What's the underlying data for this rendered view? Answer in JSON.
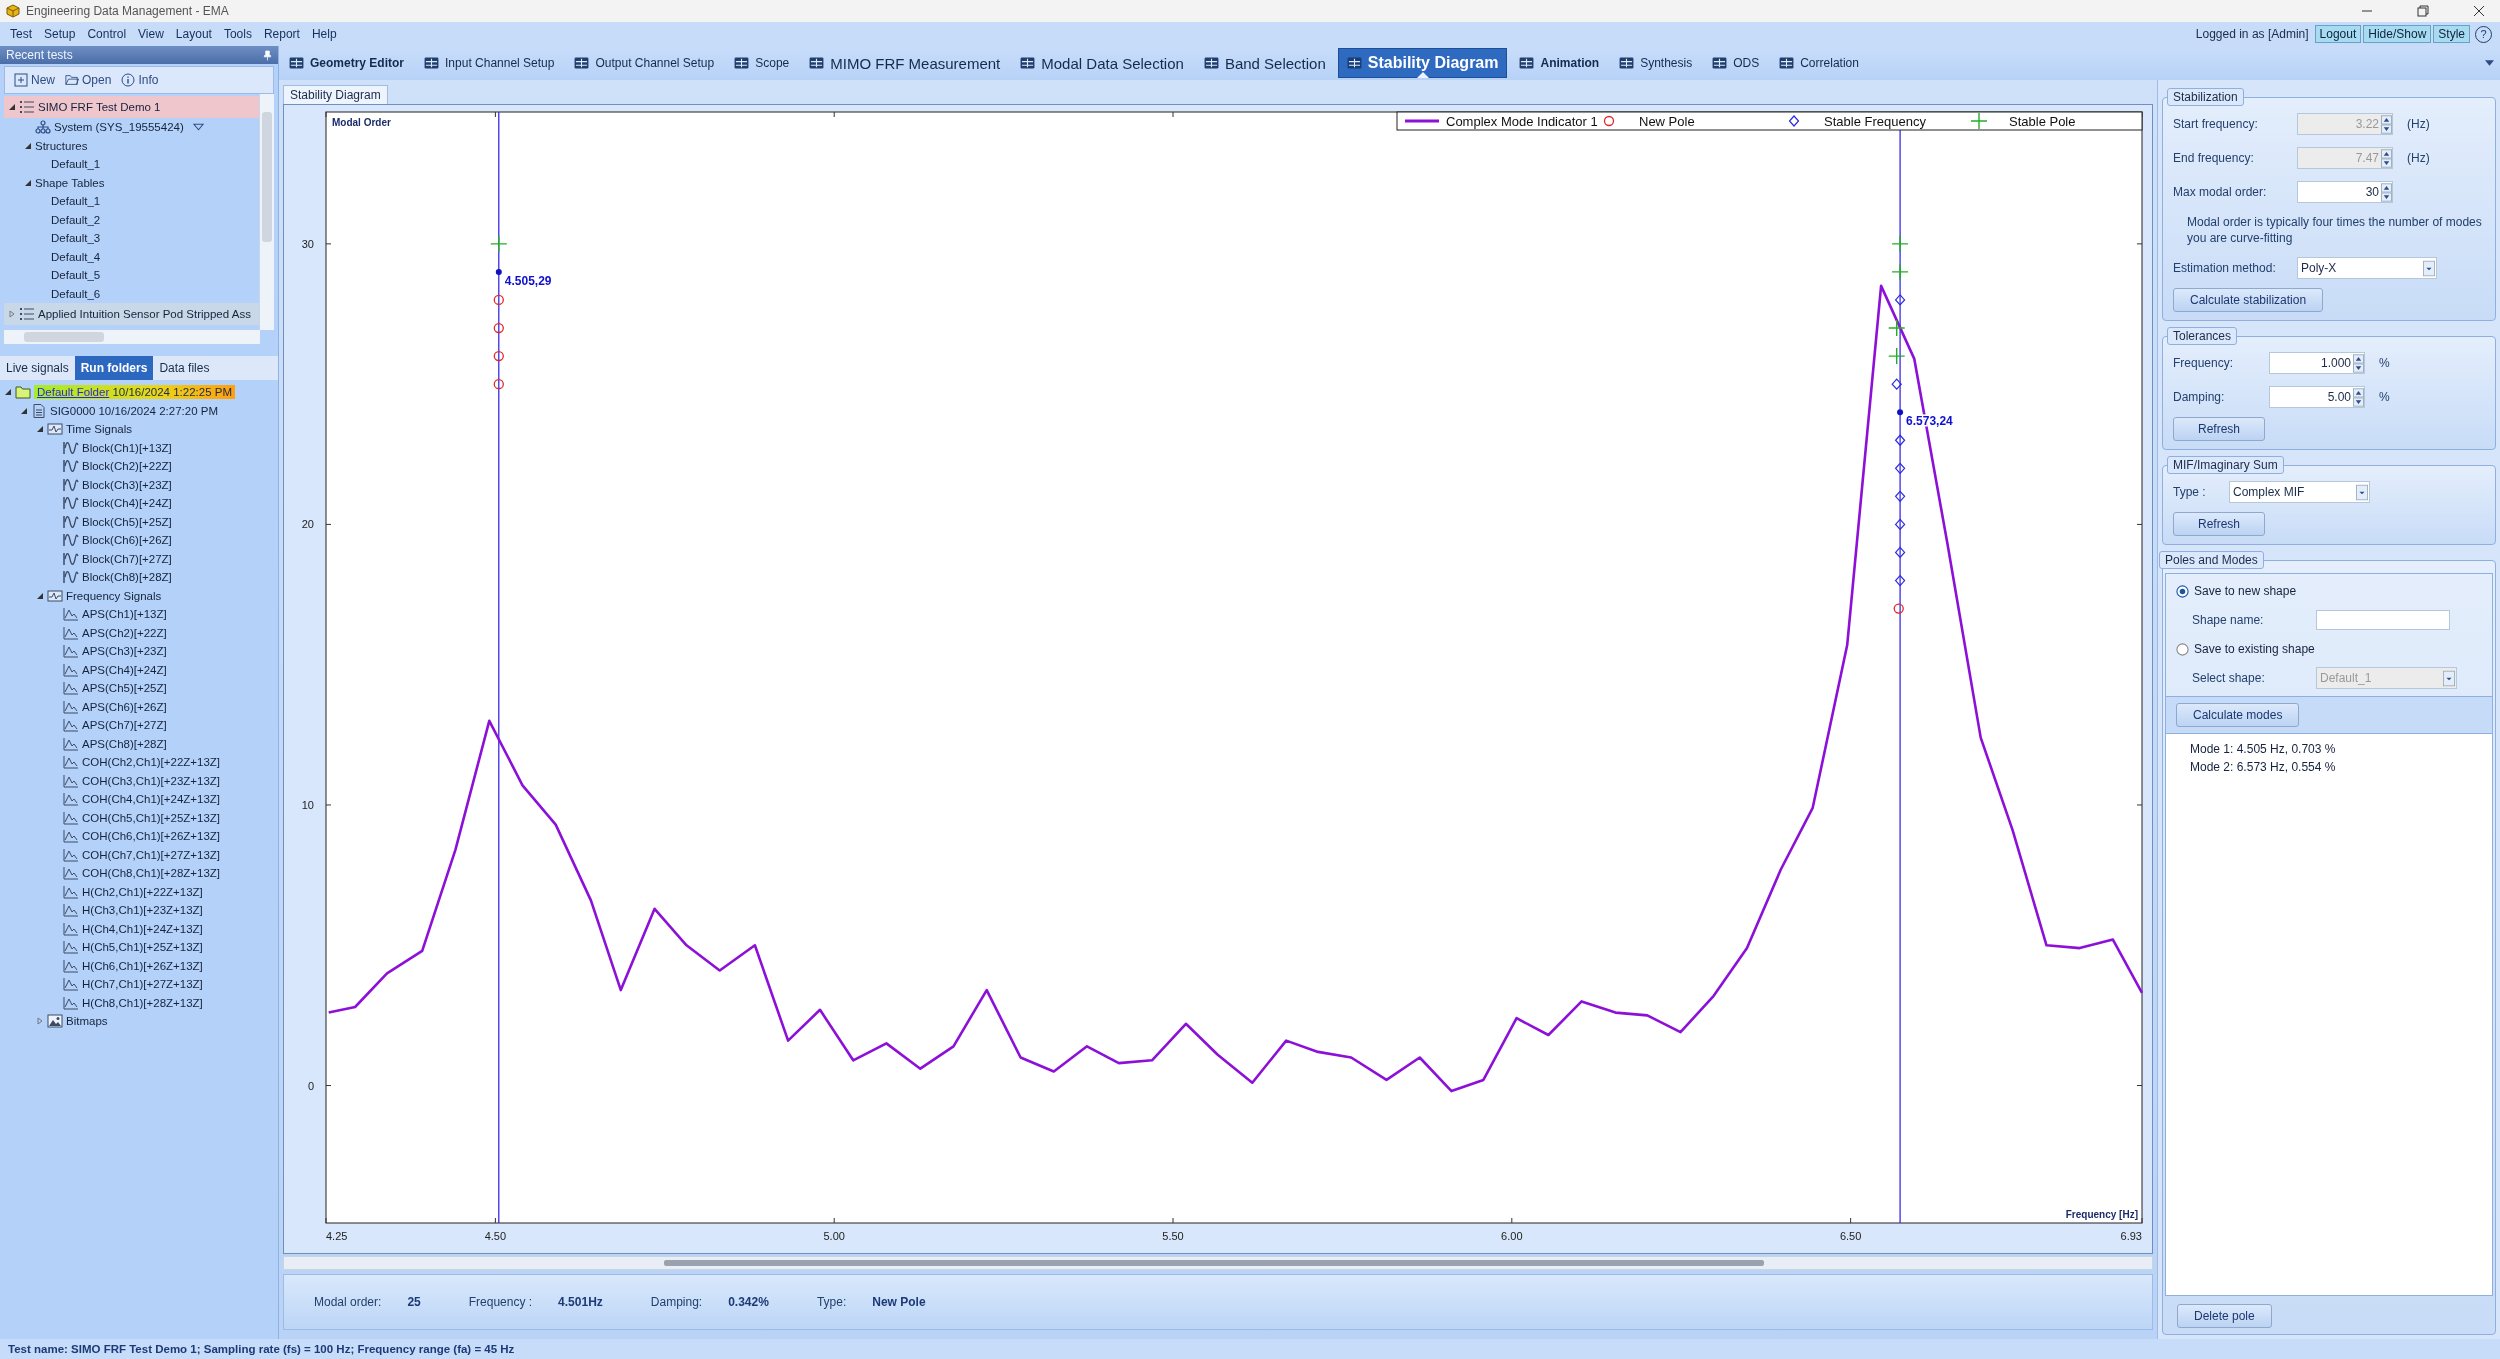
{
  "window": {
    "title": "Engineering Data Management - EMA"
  },
  "menu": [
    "Test",
    "Setup",
    "Control",
    "View",
    "Layout",
    "Tools",
    "Report",
    "Help"
  ],
  "user": {
    "login_text": "Logged in as [Admin]",
    "buttons": [
      "Logout",
      "Hide/Show",
      "Style"
    ],
    "help": "?"
  },
  "main_tabs": [
    {
      "label": "Geometry Editor",
      "kind": "bold",
      "selected": false
    },
    {
      "label": "Input Channel Setup",
      "kind": "plain",
      "selected": false
    },
    {
      "label": "Output Channel Setup",
      "kind": "plain",
      "selected": false
    },
    {
      "label": "Scope",
      "kind": "plain",
      "selected": false
    },
    {
      "label": "MIMO FRF Measurement",
      "kind": "large",
      "selected": false
    },
    {
      "label": "Modal Data Selection",
      "kind": "large",
      "selected": false
    },
    {
      "label": "Band Selection",
      "kind": "large",
      "selected": false
    },
    {
      "label": "Stability Diagram",
      "kind": "large",
      "selected": true
    },
    {
      "label": "Animation",
      "kind": "bold",
      "selected": false
    },
    {
      "label": "Synthesis",
      "kind": "plain",
      "selected": false
    },
    {
      "label": "ODS",
      "kind": "plain",
      "selected": false
    },
    {
      "label": "Correlation",
      "kind": "plain",
      "selected": false
    }
  ],
  "recent_tests": {
    "title": "Recent tests",
    "toolbar": [
      {
        "label": "New",
        "kind": "new"
      },
      {
        "label": "Open",
        "kind": "open"
      },
      {
        "label": "Info",
        "kind": "info"
      }
    ],
    "tree": [
      {
        "label": "SIMO FRF Test Demo 1",
        "kind": "test",
        "selected": true,
        "expanded": true,
        "children": [
          {
            "label": "System (SYS_19555424)",
            "kind": "system",
            "dropdown": true
          },
          {
            "label": "Structures",
            "expanded": true,
            "children": [
              {
                "label": "Default_1"
              }
            ]
          },
          {
            "label": "Shape Tables",
            "expanded": true,
            "children": [
              {
                "label": "Default_1"
              },
              {
                "label": "Default_2"
              },
              {
                "label": "Default_3"
              },
              {
                "label": "Default_4"
              },
              {
                "label": "Default_5"
              },
              {
                "label": "Default_6"
              }
            ]
          }
        ]
      },
      {
        "label": "Applied Intuition Sensor Pod Stripped Ass",
        "kind": "test",
        "selected": false,
        "expanded": false
      }
    ]
  },
  "data_tabs": [
    {
      "label": "Live signals",
      "selected": false
    },
    {
      "label": "Run folders",
      "selected": true
    },
    {
      "label": "Data files",
      "selected": false
    }
  ],
  "run_tree": [
    {
      "label": "Default Folder",
      "date": "10/16/2024 1:22:25 PM",
      "kind": "folder",
      "selected": true,
      "expanded": true,
      "children": [
        {
          "label": "SIG0000",
          "date": "10/16/2024 2:27:20 PM",
          "kind": "file",
          "expanded": true,
          "children": [
            {
              "label": "Time Signals",
              "kind": "signal_group",
              "expanded": true,
              "children": [
                {
                  "label": "Block(Ch1)[+13Z]",
                  "kind": "time"
                },
                {
                  "label": "Block(Ch2)[+22Z]",
                  "kind": "time"
                },
                {
                  "label": "Block(Ch3)[+23Z]",
                  "kind": "time"
                },
                {
                  "label": "Block(Ch4)[+24Z]",
                  "kind": "time"
                },
                {
                  "label": "Block(Ch5)[+25Z]",
                  "kind": "time"
                },
                {
                  "label": "Block(Ch6)[+26Z]",
                  "kind": "time"
                },
                {
                  "label": "Block(Ch7)[+27Z]",
                  "kind": "time"
                },
                {
                  "label": "Block(Ch8)[+28Z]",
                  "kind": "time"
                }
              ]
            },
            {
              "label": "Frequency Signals",
              "kind": "signal_group",
              "expanded": true,
              "children": [
                {
                  "label": "APS(Ch1)[+13Z]",
                  "kind": "frequency"
                },
                {
                  "label": "APS(Ch2)[+22Z]",
                  "kind": "frequency"
                },
                {
                  "label": "APS(Ch3)[+23Z]",
                  "kind": "frequency"
                },
                {
                  "label": "APS(Ch4)[+24Z]",
                  "kind": "frequency"
                },
                {
                  "label": "APS(Ch5)[+25Z]",
                  "kind": "frequency"
                },
                {
                  "label": "APS(Ch6)[+26Z]",
                  "kind": "frequency"
                },
                {
                  "label": "APS(Ch7)[+27Z]",
                  "kind": "frequency"
                },
                {
                  "label": "APS(Ch8)[+28Z]",
                  "kind": "frequency"
                },
                {
                  "label": "COH(Ch2,Ch1)[+22Z+13Z]",
                  "kind": "frequency"
                },
                {
                  "label": "COH(Ch3,Ch1)[+23Z+13Z]",
                  "kind": "frequency"
                },
                {
                  "label": "COH(Ch4,Ch1)[+24Z+13Z]",
                  "kind": "frequency"
                },
                {
                  "label": "COH(Ch5,Ch1)[+25Z+13Z]",
                  "kind": "frequency"
                },
                {
                  "label": "COH(Ch6,Ch1)[+26Z+13Z]",
                  "kind": "frequency"
                },
                {
                  "label": "COH(Ch7,Ch1)[+27Z+13Z]",
                  "kind": "frequency"
                },
                {
                  "label": "COH(Ch8,Ch1)[+28Z+13Z]",
                  "kind": "frequency"
                },
                {
                  "label": "H(Ch2,Ch1)[+22Z+13Z]",
                  "kind": "frequency"
                },
                {
                  "label": "H(Ch3,Ch1)[+23Z+13Z]",
                  "kind": "frequency"
                },
                {
                  "label": "H(Ch4,Ch1)[+24Z+13Z]",
                  "kind": "frequency"
                },
                {
                  "label": "H(Ch5,Ch1)[+25Z+13Z]",
                  "kind": "frequency"
                },
                {
                  "label": "H(Ch6,Ch1)[+26Z+13Z]",
                  "kind": "frequency"
                },
                {
                  "label": "H(Ch7,Ch1)[+27Z+13Z]",
                  "kind": "frequency"
                },
                {
                  "label": "H(Ch8,Ch1)[+28Z+13Z]",
                  "kind": "frequency"
                }
              ]
            },
            {
              "label": "Bitmaps",
              "kind": "bitmap_group",
              "expanded": false
            }
          ]
        }
      ]
    }
  ],
  "sub_tab": {
    "label": "Stability Diagram"
  },
  "chart": {
    "chart_data": {
      "type": "line",
      "xlabel": "Frequency [Hz]",
      "ylabel": "Modal Order",
      "x": [
        4.254,
        4.293,
        4.34,
        4.392,
        4.441,
        4.491,
        4.54,
        4.589,
        4.641,
        4.685,
        4.735,
        4.782,
        4.831,
        4.883,
        4.932,
        4.979,
        5.028,
        5.077,
        5.127,
        5.176,
        5.225,
        5.275,
        5.324,
        5.373,
        5.42,
        5.469,
        5.519,
        5.566,
        5.617,
        5.667,
        5.714,
        5.763,
        5.815,
        5.864,
        5.911,
        5.958,
        6.007,
        6.054,
        6.103,
        6.153,
        6.2,
        6.249,
        6.298,
        6.347,
        6.397,
        6.444,
        6.495,
        6.545,
        6.594,
        6.643,
        6.692,
        6.739,
        6.789,
        6.838,
        6.887,
        6.93
      ],
      "series": [
        {
          "name": "Complex Mode Indicator 1",
          "color": "#8c10d8",
          "values": [
            2.6,
            2.8,
            4.0,
            4.8,
            8.4,
            13.0,
            10.7,
            9.3,
            6.6,
            3.4,
            6.3,
            5.0,
            4.1,
            5.0,
            1.6,
            2.7,
            0.9,
            1.5,
            0.6,
            1.4,
            3.4,
            1.0,
            0.5,
            1.4,
            0.8,
            0.9,
            2.2,
            1.1,
            0.1,
            1.6,
            1.2,
            1.0,
            0.2,
            1.0,
            -0.2,
            0.2,
            2.4,
            1.8,
            3.0,
            2.6,
            2.5,
            1.9,
            3.2,
            4.9,
            7.7,
            9.9,
            15.7,
            28.5,
            25.9,
            19.3,
            12.4,
            9.1,
            5.0,
            4.9,
            5.2,
            3.3
          ]
        },
        {
          "name": "New Pole",
          "color": "#e02828",
          "type": "scatter",
          "marker": "circle",
          "x": [
            4.505,
            4.505,
            4.505,
            4.505,
            6.571
          ],
          "values": [
            28,
            27,
            26,
            25,
            17
          ]
        },
        {
          "name": "Stable Frequency",
          "color": "#2a2ae0",
          "type": "scatter",
          "marker": "diamond",
          "x": [
            6.573,
            6.568,
            6.573,
            6.573,
            6.573,
            6.573,
            6.573,
            6.573
          ],
          "values": [
            28,
            25,
            23,
            22,
            21,
            20,
            19,
            18
          ]
        },
        {
          "name": "Stable Pole",
          "color": "#22b022",
          "type": "scatter",
          "marker": "plus",
          "x": [
            4.505,
            6.573,
            6.573,
            6.568,
            6.568
          ],
          "values": [
            30,
            30,
            29,
            27,
            26
          ]
        }
      ],
      "ref_lines": [
        {
          "axis": "x",
          "value": 4.505,
          "color": "#3a2ae8"
        },
        {
          "axis": "x",
          "value": 6.573,
          "color": "#3a2ae8"
        }
      ],
      "legend": "upper right",
      "xlim": [
        4.25,
        6.93
      ],
      "ylim": [
        -4.9,
        34.7
      ],
      "xticks": [
        {
          "value": 4.25,
          "label": "4.25"
        },
        {
          "value": 4.5,
          "label": "4.50"
        },
        {
          "value": 5.0,
          "label": "5.00"
        },
        {
          "value": 5.5,
          "label": "5.50"
        },
        {
          "value": 6.0,
          "label": "6.00"
        },
        {
          "value": 6.5,
          "label": "6.50"
        },
        {
          "value": 6.93,
          "label": "6.93"
        }
      ],
      "yticks": [
        0,
        10,
        20,
        30
      ],
      "annotations": [
        {
          "x": 4.505,
          "y": 29,
          "text": "4.505,29"
        },
        {
          "x": 6.573,
          "y": 24,
          "text": "6.573,24"
        }
      ]
    }
  },
  "cursor_info": [
    {
      "label": "Modal order:",
      "value": "25"
    },
    {
      "label": "Frequency :",
      "value": "4.501Hz"
    },
    {
      "label": "Damping:",
      "value": "0.342%"
    },
    {
      "label": "Type:",
      "value": "New Pole"
    }
  ],
  "stabilization": {
    "title": "Stabilization",
    "fields": [
      {
        "label": "Start frequency:",
        "value": "3.22",
        "unit": "(Hz)",
        "disabled": true
      },
      {
        "label": "End frequency:",
        "value": "7.47",
        "unit": "(Hz)",
        "disabled": true
      },
      {
        "label": "Max modal order:",
        "value": "30",
        "disabled": false
      }
    ],
    "note": "Modal order is typically four times the number of modes you are curve-fitting",
    "estimation_method": {
      "label": "Estimation method:",
      "value": "Poly-X"
    },
    "button": "Calculate stabilization"
  },
  "tolerances": {
    "title": "Tolerances",
    "fields": [
      {
        "label": "Frequency:",
        "value": "1.000",
        "unit": "%",
        "disabled": false
      },
      {
        "label": "Damping:",
        "value": "5.00",
        "unit": "%",
        "disabled": false
      }
    ],
    "button": "Refresh"
  },
  "mif": {
    "title": "MIF/Imaginary Sum",
    "type": {
      "label": "Type :",
      "value": "Complex MIF"
    },
    "button": "Refresh"
  },
  "poles_and_modes": {
    "title": "Poles and Modes",
    "options": [
      {
        "label": "Save to new shape",
        "selected": true
      },
      {
        "label": "Save to existing shape",
        "selected": false
      }
    ],
    "shape_name": {
      "label": "Shape name:"
    },
    "select_shape": {
      "label": "Select shape:",
      "value": "Default_1",
      "disabled": true
    },
    "button": "Calculate modes",
    "modes": [
      "Mode 1: 4.505 Hz, 0.703 %",
      "Mode 2: 6.573 Hz, 0.554 %"
    ],
    "delete_button": "Delete pole"
  },
  "status_bar": "Test name: SIMO FRF Test Demo 1; Sampling rate (fs) = 100 Hz; Frequency range (fa) = 45 Hz"
}
